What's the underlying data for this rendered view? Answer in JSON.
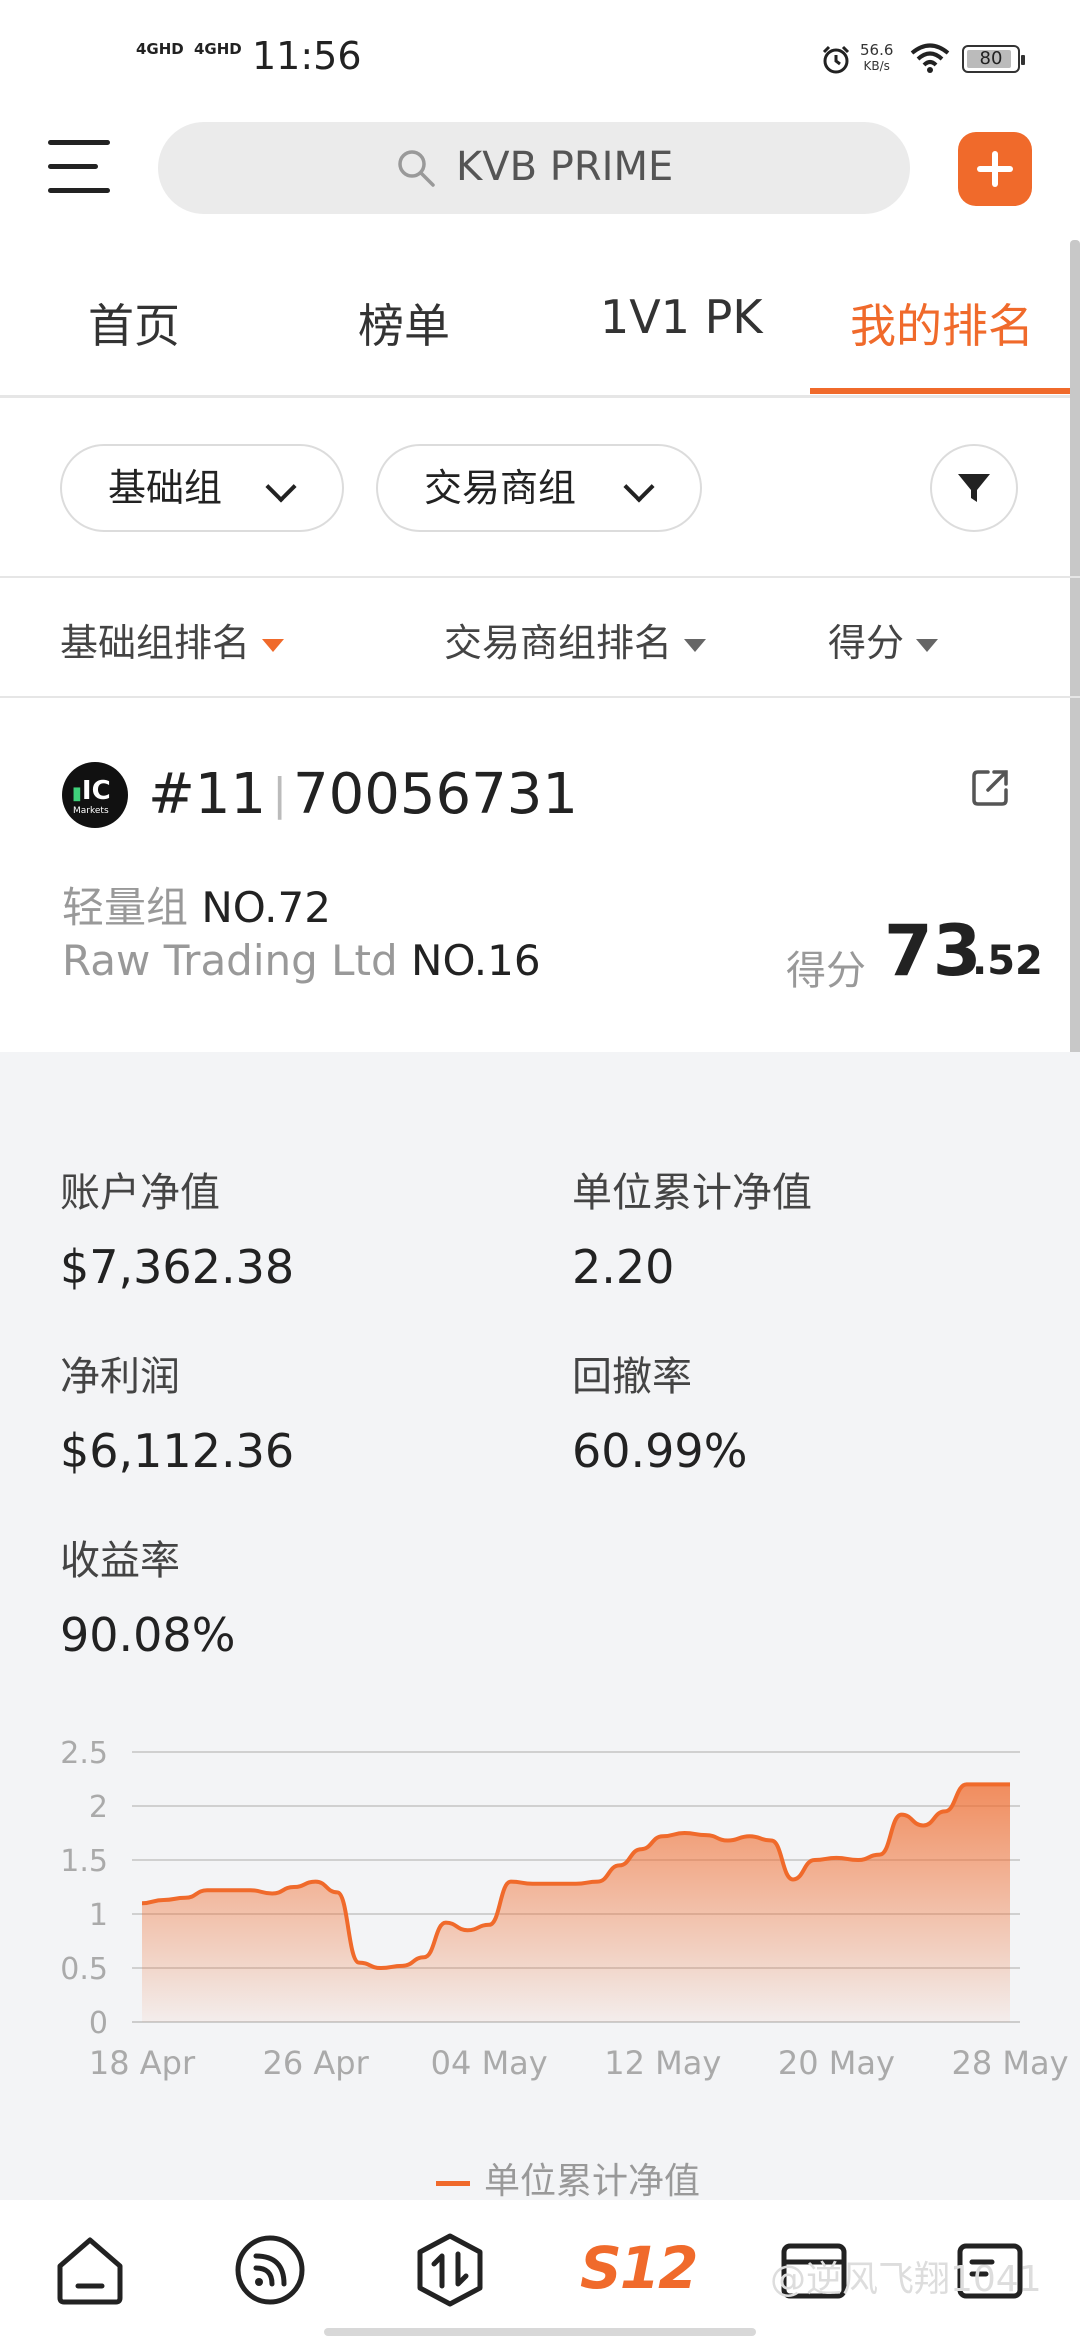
{
  "status_bar": {
    "signal1": "4GHD",
    "signal2": "4GHD",
    "time": "11:56",
    "net_speed_value": "56.6",
    "net_speed_unit": "KB/s",
    "battery": "80"
  },
  "search": {
    "placeholder": "KVB PRIME"
  },
  "tabs": [
    {
      "label": "首页"
    },
    {
      "label": "榜单"
    },
    {
      "label": "1V1 PK"
    },
    {
      "label": "我的排名",
      "active": true
    }
  ],
  "filters": {
    "group_chip": "基础组",
    "broker_chip": "交易商组"
  },
  "sort": {
    "basic_rank": "基础组排名",
    "broker_rank": "交易商组排名",
    "score": "得分"
  },
  "card": {
    "logo_text": "IC",
    "logo_sub": "Markets",
    "rank": "#11",
    "account": "70056731",
    "group_label": "轻量组",
    "group_rank": "NO.72",
    "broker_label": "Raw Trading Ltd",
    "broker_rank": "NO.16",
    "score_label": "得分",
    "score_int": "73",
    "score_dec": ".52"
  },
  "stats": {
    "equity_label": "账户净值",
    "equity_value": "$7,362.38",
    "unit_nav_label": "单位累计净值",
    "unit_nav_value": "2.20",
    "profit_label": "净利润",
    "profit_value": "$6,112.36",
    "drawdown_label": "回撤率",
    "drawdown_value": "60.99%",
    "return_label": "收益率",
    "return_value": "90.08%"
  },
  "chart_data": {
    "type": "area",
    "series": [
      {
        "name": "单位累计净值",
        "x": [
          "2024-04-18",
          "2024-04-19",
          "2024-04-20",
          "2024-04-21",
          "2024-04-22",
          "2024-04-23",
          "2024-04-24",
          "2024-04-25",
          "2024-04-26",
          "2024-04-27",
          "2024-04-28",
          "2024-04-29",
          "2024-04-30",
          "2024-05-01",
          "2024-05-02",
          "2024-05-03",
          "2024-05-04",
          "2024-05-05",
          "2024-05-06",
          "2024-05-07",
          "2024-05-08",
          "2024-05-09",
          "2024-05-10",
          "2024-05-11",
          "2024-05-12",
          "2024-05-13",
          "2024-05-14",
          "2024-05-15",
          "2024-05-16",
          "2024-05-17",
          "2024-05-18",
          "2024-05-19",
          "2024-05-20",
          "2024-05-21",
          "2024-05-22",
          "2024-05-23",
          "2024-05-24",
          "2024-05-25",
          "2024-05-26",
          "2024-05-27",
          "2024-05-28"
        ],
        "values": [
          1.1,
          1.13,
          1.15,
          1.22,
          1.22,
          1.22,
          1.19,
          1.25,
          1.3,
          1.2,
          0.55,
          0.5,
          0.52,
          0.6,
          0.92,
          0.85,
          0.9,
          1.3,
          1.28,
          1.28,
          1.28,
          1.3,
          1.45,
          1.6,
          1.72,
          1.75,
          1.73,
          1.68,
          1.72,
          1.68,
          1.32,
          1.5,
          1.52,
          1.5,
          1.55,
          1.92,
          1.82,
          1.95,
          2.2,
          2.2,
          2.2
        ]
      }
    ],
    "ylim": [
      0,
      2.5
    ],
    "yticks": [
      "0",
      "0.5",
      "1",
      "1.5",
      "2",
      "2.5"
    ],
    "xticks": [
      "18 Apr",
      "26 Apr",
      "04 May",
      "12 May",
      "20 May",
      "28 May"
    ],
    "grid": true,
    "legend": "bottom-center",
    "color": "#f06a2b"
  },
  "bottom_nav": {
    "active_label": "S12",
    "watermark": "@逆风飞翔1041"
  }
}
